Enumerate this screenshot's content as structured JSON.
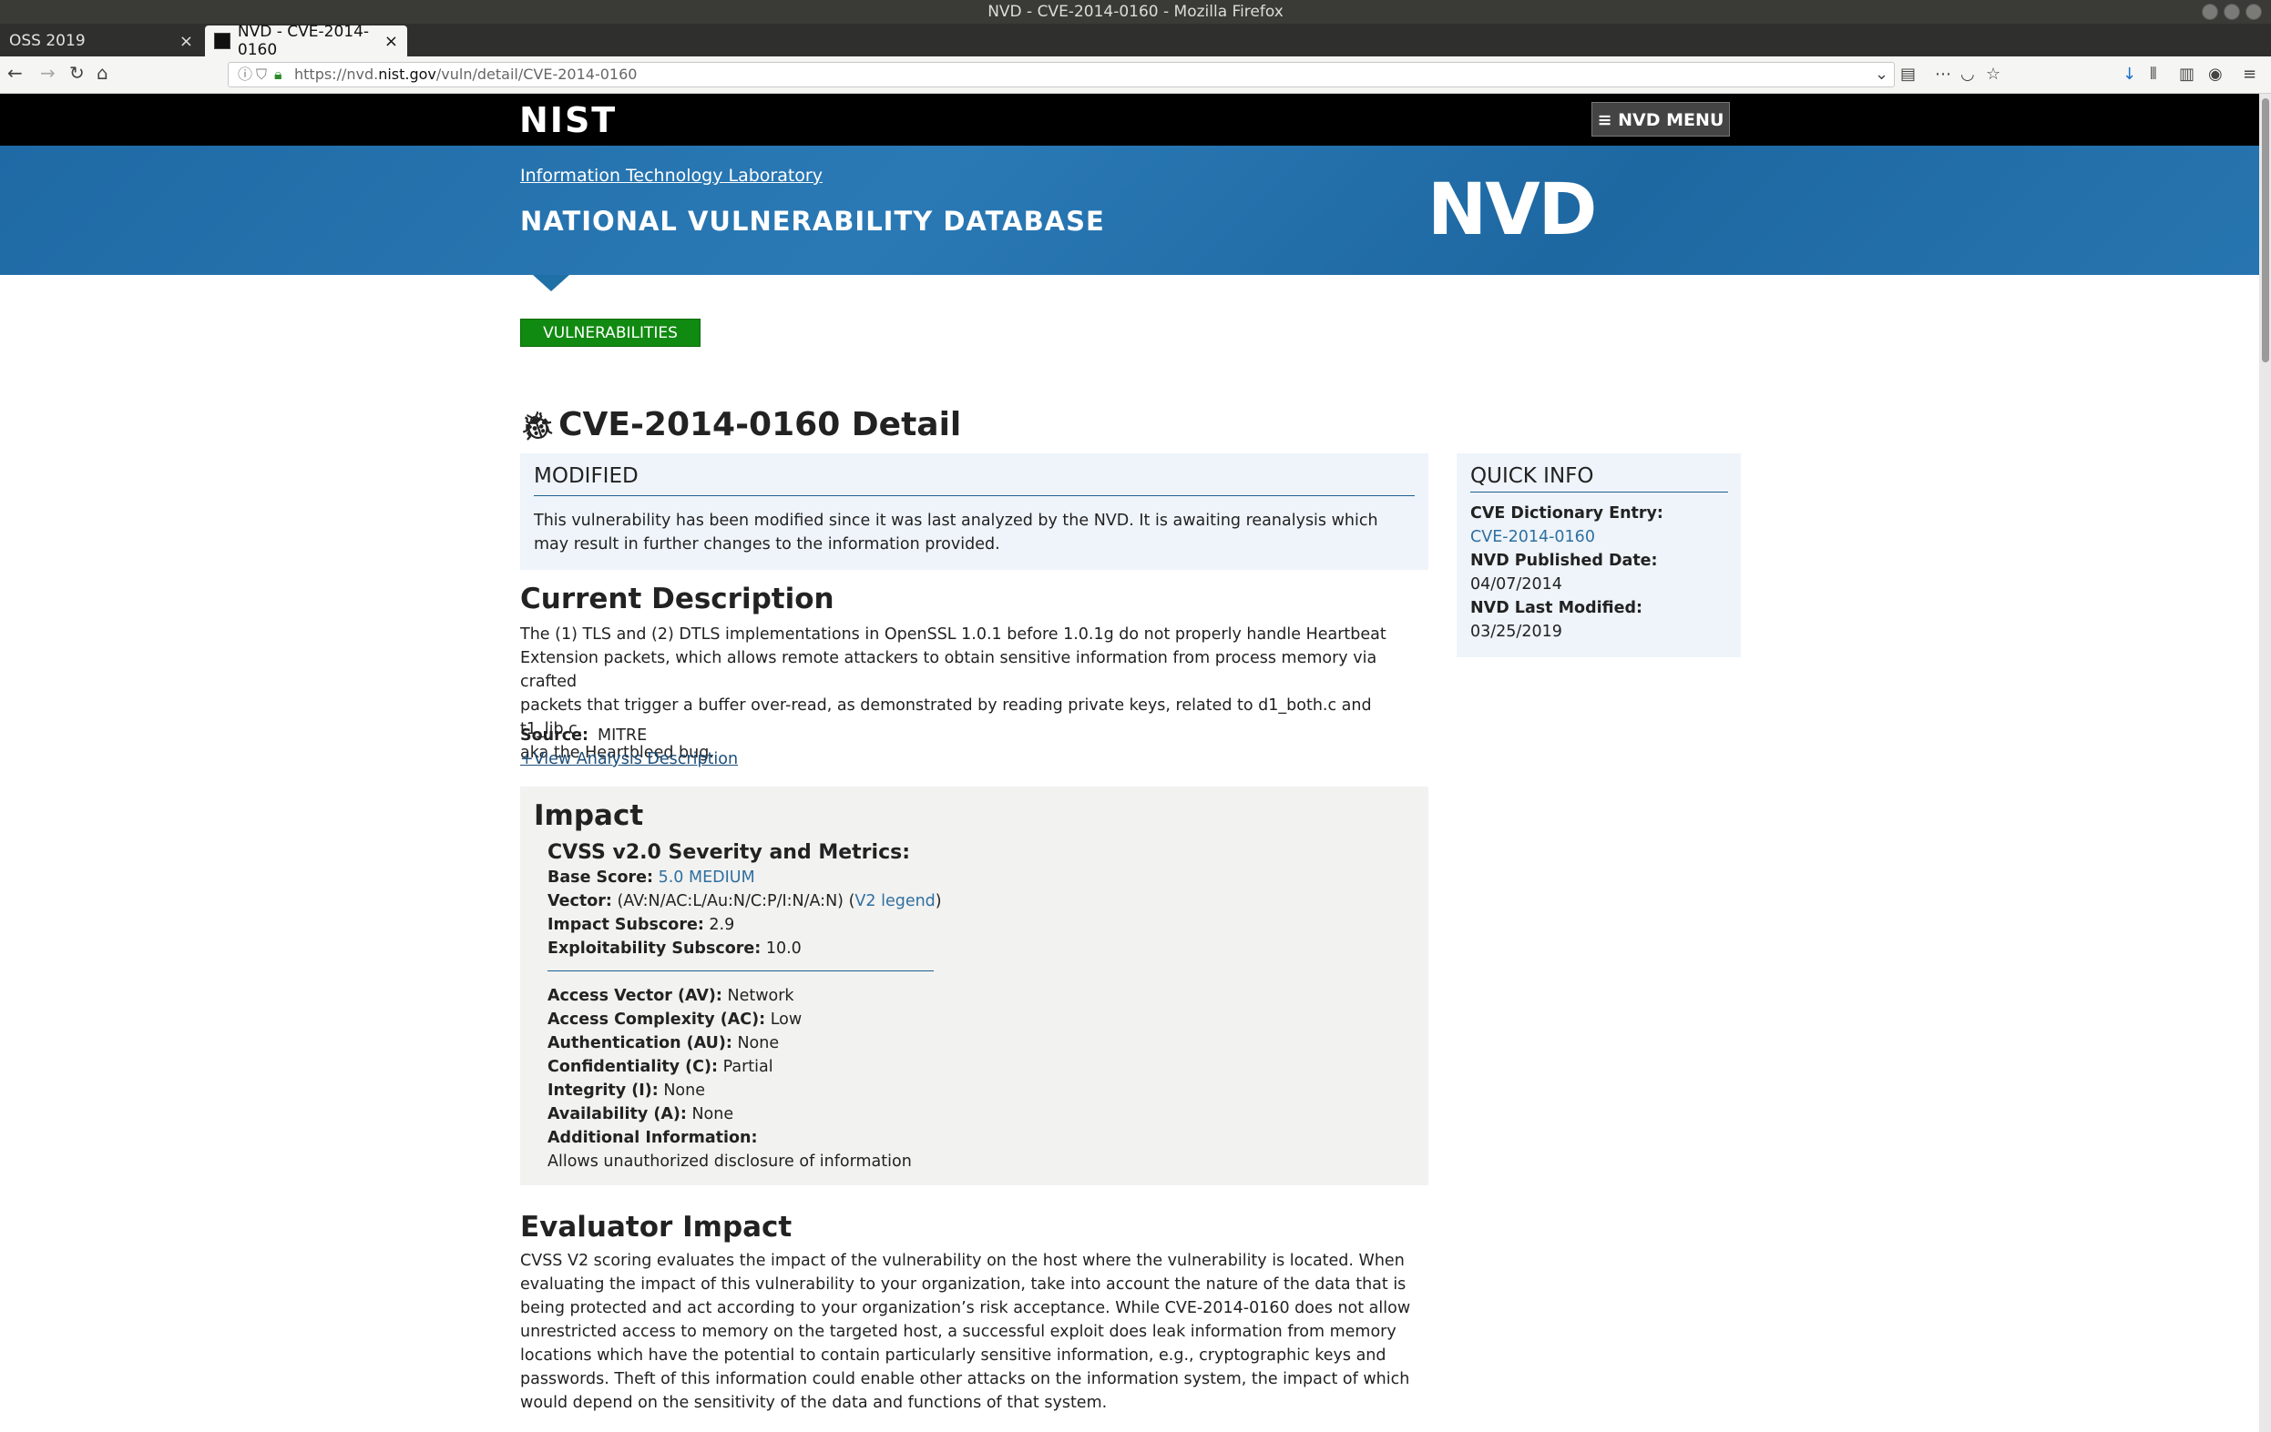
{
  "window": {
    "title": "NVD - CVE-2014-0160 - Mozilla Firefox"
  },
  "tabs": [
    {
      "label": "OSS 2019"
    },
    {
      "label": "NVD - CVE-2014-0160"
    }
  ],
  "address_bar": {
    "url_prefix": "https://nvd.",
    "url_host": "nist.gov",
    "url_path": "/vuln/detail/CVE-2014-0160"
  },
  "header": {
    "nist_logo": "NIST",
    "menu_label": "≡ NVD MENU",
    "itl_link": "Information Technology Laboratory",
    "db_title": "NATIONAL VULNERABILITY DATABASE",
    "nvd_logo": "NVD"
  },
  "nav": {
    "vulnerabilities_label": "VULNERABILITIES"
  },
  "detail": {
    "title": "CVE-2014-0160 Detail",
    "modified_title": "MODIFIED",
    "modified_text": "This vulnerability has been modified since it was last analyzed by the NVD. It is awaiting reanalysis which may result in further changes to the information provided.",
    "current_description_title": "Current Description",
    "description_lines": [
      "The (1) TLS and (2) DTLS implementations in OpenSSL 1.0.1 before 1.0.1g do not properly handle Heartbeat",
      "Extension packets, which allows remote attackers to obtain sensitive information from process memory via crafted",
      "packets that trigger a buffer over-read, as demonstrated by reading private keys, related to d1_both.c and t1_lib.c,",
      "aka the Heartbleed bug."
    ],
    "source_label": "Source:",
    "source_value": "MITRE",
    "view_analysis": "+View Analysis Description"
  },
  "impact": {
    "title": "Impact",
    "cvss_title": "CVSS v2.0 Severity and Metrics:",
    "base_score_label": "Base Score:",
    "base_score_value": "5.0 MEDIUM",
    "vector_label": "Vector:",
    "vector_value": "(AV:N/AC:L/Au:N/C:P/I:N/A:N)",
    "vector_legend_open": "(",
    "vector_legend": "V2 legend",
    "vector_legend_close": ")",
    "impact_subscore_label": "Impact Subscore:",
    "impact_subscore_value": "2.9",
    "exploitability_label": "Exploitability Subscore:",
    "exploitability_value": "10.0",
    "metrics": [
      {
        "label": "Access Vector (AV):",
        "value": "Network"
      },
      {
        "label": "Access Complexity (AC):",
        "value": "Low"
      },
      {
        "label": "Authentication (AU):",
        "value": "None"
      },
      {
        "label": "Confidentiality (C):",
        "value": "Partial"
      },
      {
        "label": "Integrity (I):",
        "value": "None"
      },
      {
        "label": "Availability (A):",
        "value": "None"
      },
      {
        "label": "Additional Information:",
        "value": ""
      }
    ],
    "additional_info": "Allows unauthorized disclosure of information"
  },
  "evaluator": {
    "title": "Evaluator Impact",
    "lines": [
      "CVSS V2 scoring evaluates the impact of the vulnerability on the host where the vulnerability is located. When",
      "evaluating the impact of this vulnerability to your organization, take into account the nature of the data that is",
      "being protected and act according to your organization’s risk acceptance. While CVE-2014-0160 does not allow",
      "unrestricted access to memory on the targeted host, a successful exploit does leak information from memory",
      "locations which have the potential to contain particularly sensitive information, e.g., cryptographic keys and",
      "passwords. Theft of this information could enable other attacks on the information system, the impact of which",
      "would depend on the sensitivity of the data and functions of that system."
    ]
  },
  "quick_info": {
    "title": "QUICK INFO",
    "dict_label": "CVE Dictionary Entry:",
    "dict_value": "CVE-2014-0160",
    "published_label": "NVD Published Date:",
    "published_value": "04/07/2014",
    "modified_label": "NVD Last Modified:",
    "modified_value": "03/25/2019"
  },
  "colors": {
    "banner_blue": "#2070a8",
    "vuln_green": "#118a11",
    "link_blue": "#2f6f9f",
    "panel_bg": "#eef4fa"
  }
}
